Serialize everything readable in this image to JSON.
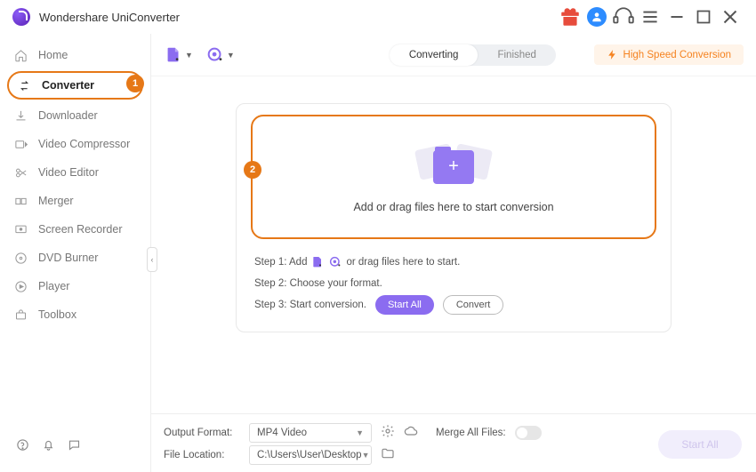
{
  "app": {
    "title": "Wondershare UniConverter"
  },
  "sidebar": {
    "items": [
      {
        "label": "Home"
      },
      {
        "label": "Converter"
      },
      {
        "label": "Downloader"
      },
      {
        "label": "Video Compressor"
      },
      {
        "label": "Video Editor"
      },
      {
        "label": "Merger"
      },
      {
        "label": "Screen Recorder"
      },
      {
        "label": "DVD Burner"
      },
      {
        "label": "Player"
      },
      {
        "label": "Toolbox"
      }
    ]
  },
  "callouts": {
    "sidebar": "1",
    "dropzone": "2"
  },
  "toolbar": {
    "tabs": {
      "converting": "Converting",
      "finished": "Finished"
    },
    "hsc": "High Speed Conversion"
  },
  "dropzone": {
    "text": "Add or drag files here to start conversion"
  },
  "steps": {
    "s1a": "Step 1: Add",
    "s1b": "or drag files here to start.",
    "s2": "Step 2: Choose your format.",
    "s3": "Step 3: Start conversion.",
    "start_all": "Start All",
    "convert": "Convert"
  },
  "footer": {
    "output_label": "Output Format:",
    "output_value": "MP4 Video",
    "location_label": "File Location:",
    "location_value": "C:\\Users\\User\\Desktop",
    "merge_label": "Merge All Files:",
    "start_all": "Start All"
  }
}
